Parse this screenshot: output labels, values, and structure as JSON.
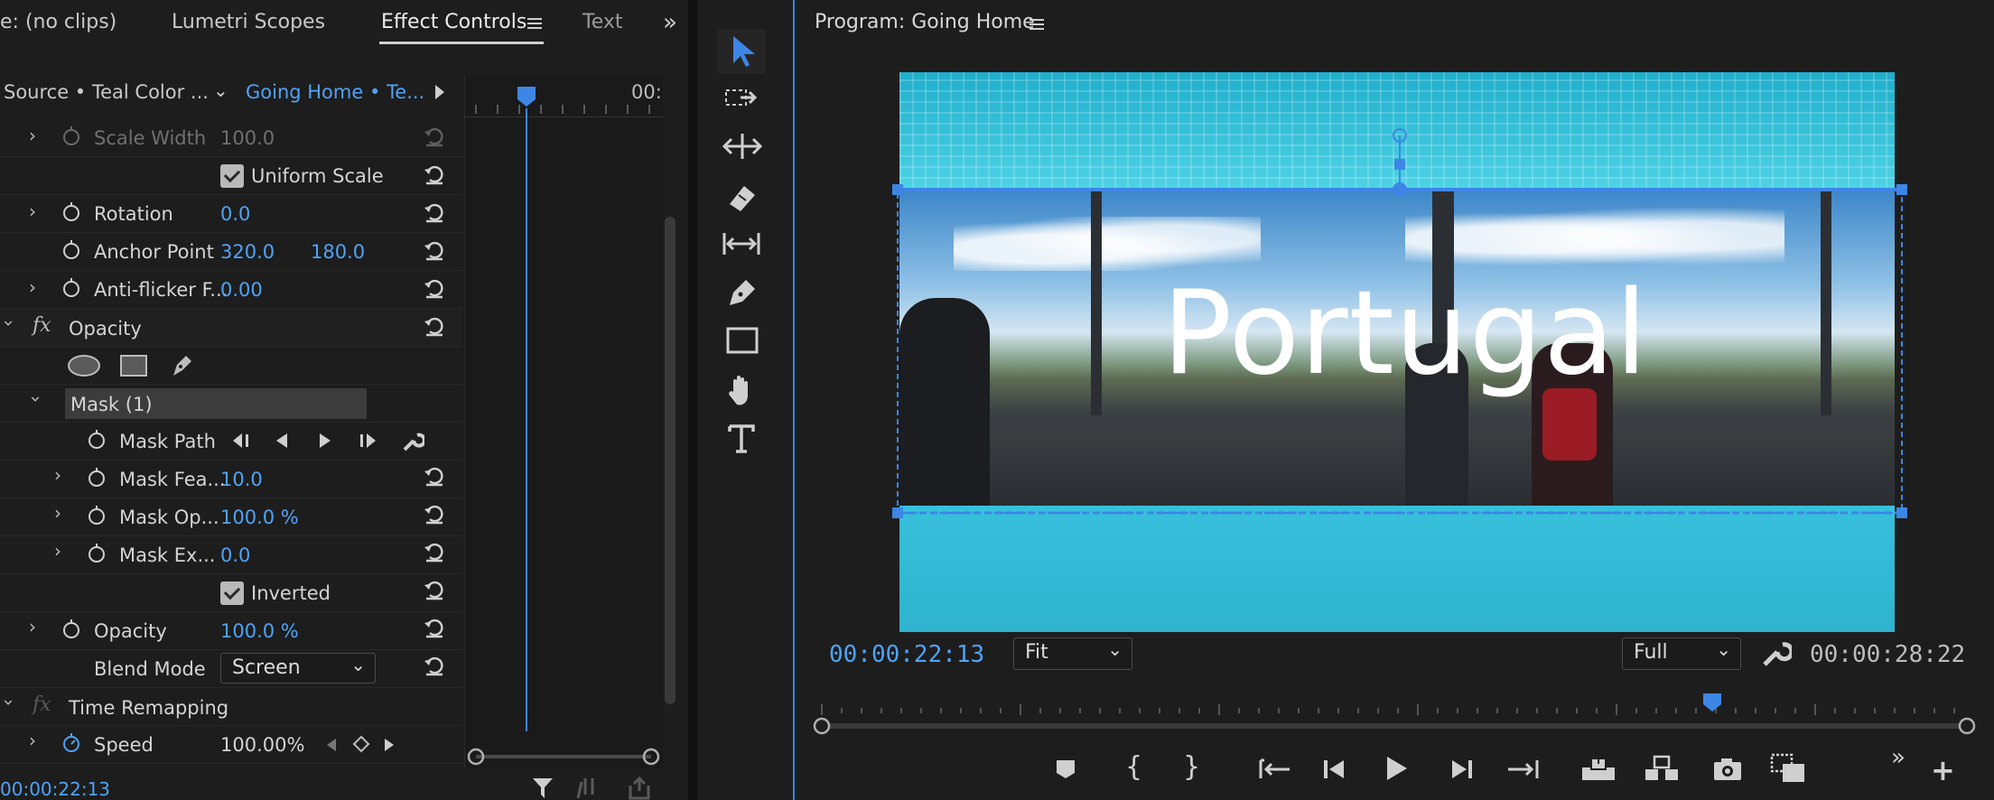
{
  "left_panel": {
    "tabs": [
      "e: (no clips)",
      "Lumetri Scopes",
      "Effect Controls",
      "Text"
    ],
    "source_label": "Source • Teal Color ...",
    "sequence_label": "Going Home • Te...",
    "ruler_time": "00:",
    "footer_time": "00:00:22:13",
    "rows": {
      "scale_width": {
        "label": "Scale Width",
        "value": "100.0"
      },
      "uniform_scale": {
        "label": "Uniform Scale"
      },
      "rotation": {
        "label": "Rotation",
        "value": "0.0"
      },
      "anchor_point": {
        "label": "Anchor Point",
        "x": "320.0",
        "y": "180.0"
      },
      "anti_flicker": {
        "label": "Anti-flicker F...",
        "value": "0.00"
      },
      "opacity_section": {
        "label": "Opacity"
      },
      "mask": {
        "label": "Mask (1)"
      },
      "mask_path": {
        "label": "Mask Path"
      },
      "mask_feather": {
        "label": "Mask Fea...",
        "value": "10.0"
      },
      "mask_opacity": {
        "label": "Mask Op...",
        "value": "100.0 %"
      },
      "mask_expansion": {
        "label": "Mask Ex...",
        "value": "0.0"
      },
      "inverted": {
        "label": "Inverted"
      },
      "opacity": {
        "label": "Opacity",
        "value": "100.0 %"
      },
      "blend_mode": {
        "label": "Blend Mode",
        "value": "Screen"
      },
      "time_remapping": {
        "label": "Time Remapping"
      },
      "speed": {
        "label": "Speed",
        "value": "100.00%"
      }
    },
    "fx_label": "fx"
  },
  "program_monitor": {
    "title": "Program: Going Home",
    "overlay_text": "Portugal",
    "current_time": "00:00:22:13",
    "zoom": "Fit",
    "resolution": "Full",
    "duration": "00:00:28:22",
    "playhead_fraction": 0.775
  },
  "colors": {
    "accent": "#4fa3f7",
    "panel_bg": "#1d1d1d",
    "teal": "#2ab8d4"
  }
}
